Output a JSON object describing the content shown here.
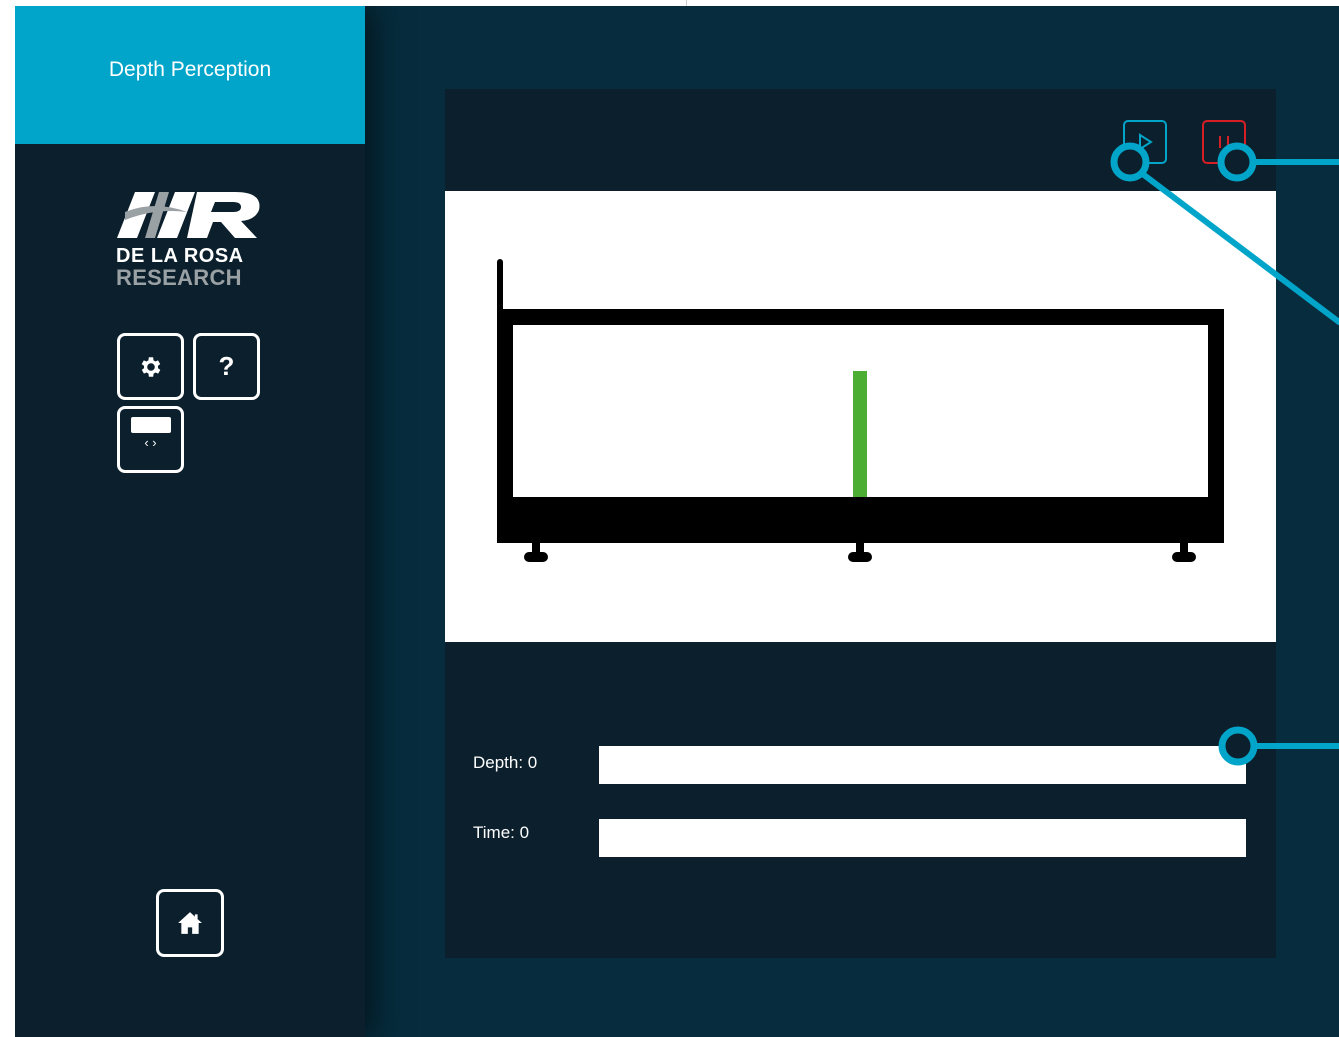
{
  "app": {
    "title": "Depth Perception"
  },
  "sidebar": {
    "logo": {
      "line1": "DE LA ROSA",
      "line2": "RESEARCH",
      "monogram": "HR"
    },
    "buttons": [
      {
        "name": "settings",
        "icon": "gear-icon"
      },
      {
        "name": "help",
        "label": "?"
      },
      {
        "name": "display",
        "icon": "display-adjust-icon",
        "glyph": "‹ ›"
      },
      {
        "name": "home",
        "icon": "home-icon"
      }
    ]
  },
  "controls": {
    "play_icon": "play-icon",
    "stop_icon": "stop-icon"
  },
  "apparatus": {
    "rod_color": "#4caf33"
  },
  "readouts": {
    "depth_label": "Depth: 0",
    "time_label": "Time: 0",
    "depth_value": "",
    "time_value": ""
  },
  "colors": {
    "accent": "#00a5c9",
    "background": "#062c3d",
    "panel": "#0c1f2c",
    "stop": "#d51f25"
  }
}
